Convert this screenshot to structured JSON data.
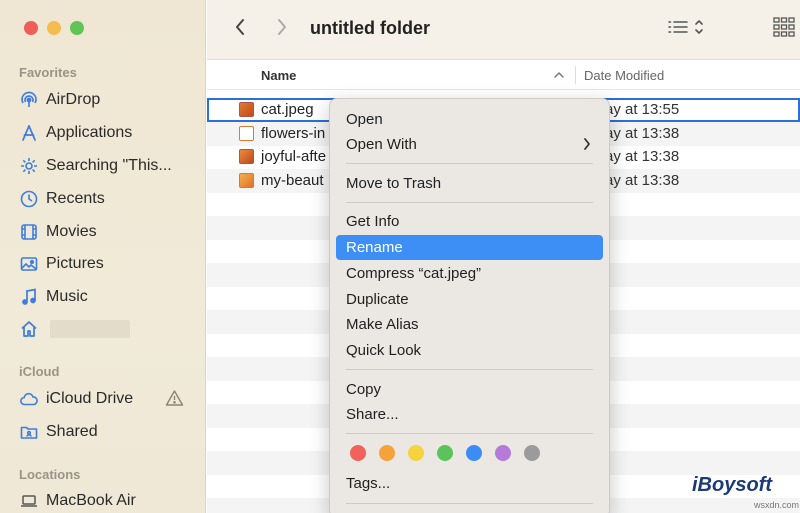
{
  "window": {
    "title": "untitled folder"
  },
  "traffic_lights": {
    "close": "#ee5f57",
    "minimize": "#f5bd4f",
    "zoom": "#61c555"
  },
  "sidebar": {
    "favorites_title": "Favorites",
    "favorites": [
      {
        "label": "AirDrop",
        "icon": "airdrop-icon"
      },
      {
        "label": "Applications",
        "icon": "applications-icon"
      },
      {
        "label": "Searching \"This...",
        "icon": "gear-icon"
      },
      {
        "label": "Recents",
        "icon": "clock-icon"
      },
      {
        "label": "Movies",
        "icon": "movies-icon"
      },
      {
        "label": "Pictures",
        "icon": "pictures-icon"
      },
      {
        "label": "Music",
        "icon": "music-icon"
      },
      {
        "label": "",
        "icon": "home-icon"
      }
    ],
    "icloud_title": "iCloud",
    "icloud": [
      {
        "label": "iCloud Drive",
        "icon": "cloud-icon"
      },
      {
        "label": "Shared",
        "icon": "shared-folder-icon"
      }
    ],
    "locations_title": "Locations",
    "locations": [
      {
        "label": "MacBook Air",
        "icon": "laptop-icon"
      }
    ]
  },
  "columns": {
    "name": "Name",
    "date_modified": "Date Modified"
  },
  "files": [
    {
      "name": "cat.jpeg",
      "date": "ay at 13:55",
      "selected": true
    },
    {
      "name": "flowers-in",
      "date": "ay at 13:38",
      "selected": false
    },
    {
      "name": "joyful-afte",
      "date": "ay at 13:38",
      "selected": false
    },
    {
      "name": "my-beaut",
      "date": "ay at 13:38",
      "selected": false
    }
  ],
  "context_menu": {
    "items": [
      {
        "label": "Open"
      },
      {
        "label": "Open With",
        "submenu": true
      },
      {
        "label": "Move to Trash"
      },
      {
        "label": "Get Info"
      },
      {
        "label": "Rename",
        "highlighted": true
      },
      {
        "label": "Compress “cat.jpeg”"
      },
      {
        "label": "Duplicate"
      },
      {
        "label": "Make Alias"
      },
      {
        "label": "Quick Look"
      },
      {
        "label": "Copy"
      },
      {
        "label": "Share..."
      },
      {
        "label": "Tags..."
      }
    ],
    "tag_colors": [
      "#f0625b",
      "#f5a23a",
      "#f6d23f",
      "#5ac45b",
      "#3b8cf3",
      "#b67bd9",
      "#9b9b9b"
    ],
    "highlight_color": "#3d8ff5"
  },
  "watermark": {
    "brand": "iBoysoft",
    "site": "wsxdn.com"
  }
}
